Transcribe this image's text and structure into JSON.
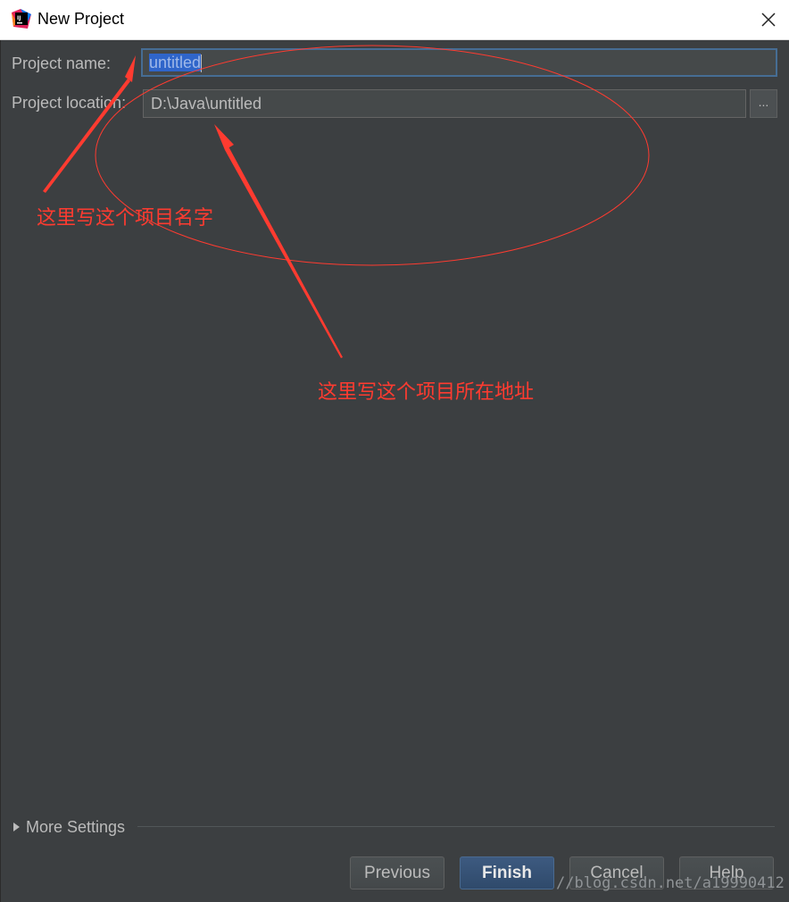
{
  "window": {
    "title": "New Project"
  },
  "form": {
    "name_label": "Project name:",
    "name_value": "untitled",
    "location_label": "Project location:",
    "location_value": "D:\\Java\\untitled",
    "browse_label": "..."
  },
  "more_settings_label": "More Settings",
  "buttons": {
    "previous": "Previous",
    "finish": "Finish",
    "cancel": "Cancel",
    "help": "Help"
  },
  "annotations": {
    "name_note": "这里写这个项目名字",
    "location_note": "这里写这个项目所在地址"
  },
  "watermark": "//blog.csdn.net/a19990412",
  "colors": {
    "annotation": "#ff3b30",
    "background": "#3c3f41",
    "accent": "#466d94"
  }
}
